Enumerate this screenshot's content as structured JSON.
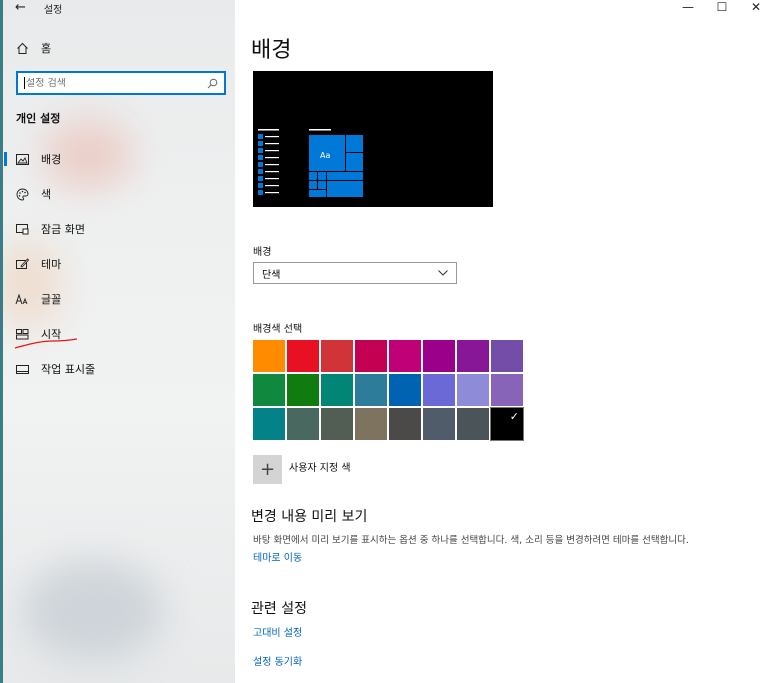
{
  "window": {
    "title": "설정"
  },
  "sidebar": {
    "home_label": "홈",
    "search_placeholder": "설정 검색",
    "section_title": "개인 설정",
    "items": [
      {
        "label": "배경",
        "icon": "picture-icon",
        "selected": true
      },
      {
        "label": "색",
        "icon": "palette-icon"
      },
      {
        "label": "잠금 화면",
        "icon": "lock-screen-icon"
      },
      {
        "label": "테마",
        "icon": "theme-brush-icon"
      },
      {
        "label": "글꼴",
        "icon": "font-icon"
      },
      {
        "label": "시작",
        "icon": "start-tiles-icon"
      },
      {
        "label": "작업 표시줄",
        "icon": "taskbar-icon"
      }
    ]
  },
  "main": {
    "title": "배경",
    "background_label": "배경",
    "background_value": "단색",
    "color_picker_label": "배경색 선택",
    "swatches": [
      "#ff8c00",
      "#e81123",
      "#d13438",
      "#c30052",
      "#bf0077",
      "#9a0089",
      "#881798",
      "#744da9",
      "#10893e",
      "#107c10",
      "#018574",
      "#2d7d9a",
      "#0063b1",
      "#6b69d6",
      "#8e8cd8",
      "#8764b8",
      "#038387",
      "#486860",
      "#525e54",
      "#7e735f",
      "#4c4a48",
      "#515c6b",
      "#4a5459",
      "#000000"
    ],
    "selected_swatch": 23,
    "custom_color_label": "사용자 지정 색",
    "preview_section_title": "변경 내용 미리 보기",
    "preview_section_desc": "바탕 화면에서 미리 보기를 표시하는 옵션 중 하나를 선택합니다. 색, 소리 등을 변경하려면 테마를 선택합니다.",
    "theme_link": "테마로 이동",
    "related_title": "관련 설정",
    "related_links": [
      "고대비 설정",
      "설정 동기화"
    ],
    "preview_tile_text": "Aa"
  },
  "colors": {
    "accent": "#0078d7",
    "link": "#0067c0"
  }
}
